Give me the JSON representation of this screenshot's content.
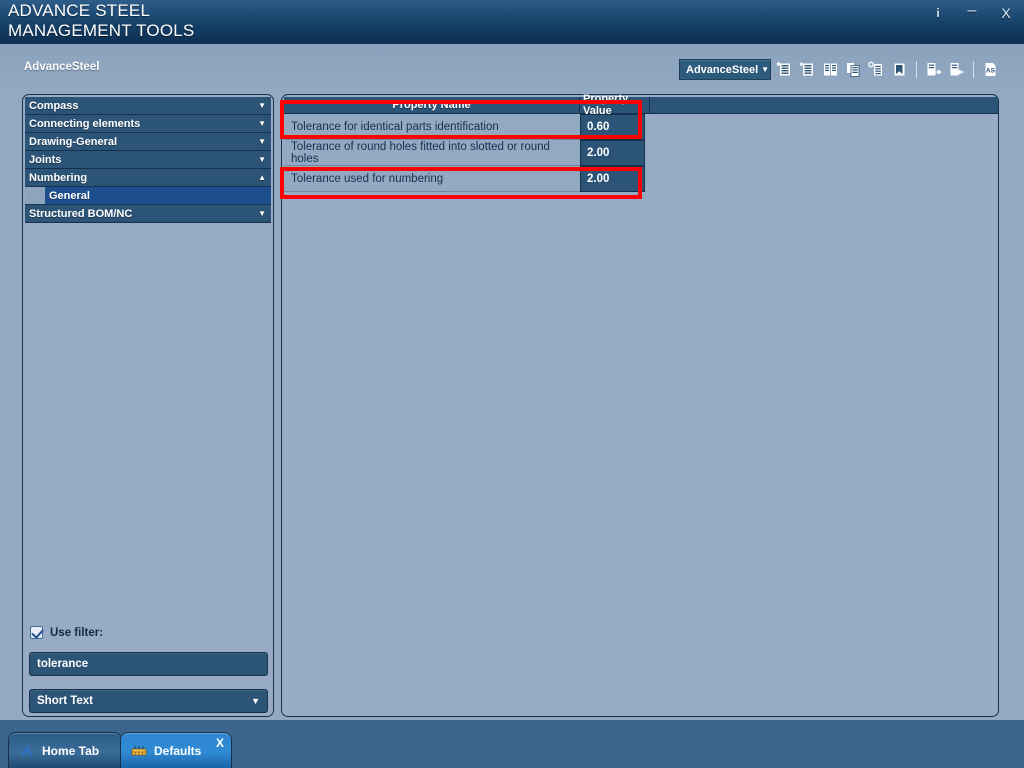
{
  "window": {
    "title": "ADVANCE STEEL\nMANAGEMENT TOOLS",
    "info_label": "i",
    "minimize_label": "–",
    "close_label": "X"
  },
  "breadcrumb": "AdvanceSteel",
  "toolbar": {
    "profile_combo": {
      "value": "AdvanceSteel",
      "arrow": "▼"
    },
    "icons": [
      "new-table-icon",
      "new-table-star-icon",
      "table-compare-icon",
      "copy-table-icon",
      "paste-table-icon",
      "flag-table-icon",
      "import-table-icon",
      "export-table-icon",
      "as-document-icon"
    ]
  },
  "tree": {
    "items": [
      {
        "label": "Compass",
        "arrow": "▼",
        "expanded": false,
        "child": false
      },
      {
        "label": "Connecting elements",
        "arrow": "▼",
        "expanded": false,
        "child": false
      },
      {
        "label": "Drawing-General",
        "arrow": "▼",
        "expanded": false,
        "child": false
      },
      {
        "label": "Joints",
        "arrow": "▼",
        "expanded": false,
        "child": false
      },
      {
        "label": "Numbering",
        "arrow": "▲",
        "expanded": true,
        "child": false
      },
      {
        "label": "General",
        "arrow": "",
        "expanded": false,
        "child": true,
        "selected": true
      },
      {
        "label": "Structured BOM/NC",
        "arrow": "▼",
        "expanded": false,
        "child": false
      }
    ]
  },
  "filter": {
    "checkbox_label": "Use filter:",
    "checked": true,
    "search_value": "tolerance",
    "search_placeholder": "tolerance",
    "mode_combo": {
      "value": "Short Text",
      "arrow": "▼"
    }
  },
  "grid": {
    "columns": [
      "Property Name",
      "Property Value"
    ],
    "rows": [
      {
        "name": "Tolerance for identical parts identification",
        "value": "0.60",
        "highlighted": true
      },
      {
        "name": "Tolerance of round holes fitted into slotted or round holes",
        "value": "2.00",
        "highlighted": false
      },
      {
        "name": "Tolerance used for numbering",
        "value": "2.00",
        "highlighted": true
      }
    ]
  },
  "tabs": [
    {
      "label": "Home Tab",
      "icon": "autodesk-a-icon",
      "active": false,
      "closable": false,
      "close_label": ""
    },
    {
      "label": "Defaults",
      "icon": "defaults-table-icon",
      "active": true,
      "closable": true,
      "close_label": "X"
    }
  ],
  "colors": {
    "accent": "#1d4f8e",
    "panel": "#97abc4",
    "row_dark": "#2c5476",
    "highlight": "#fe0000",
    "titlebar": "#123a60"
  }
}
